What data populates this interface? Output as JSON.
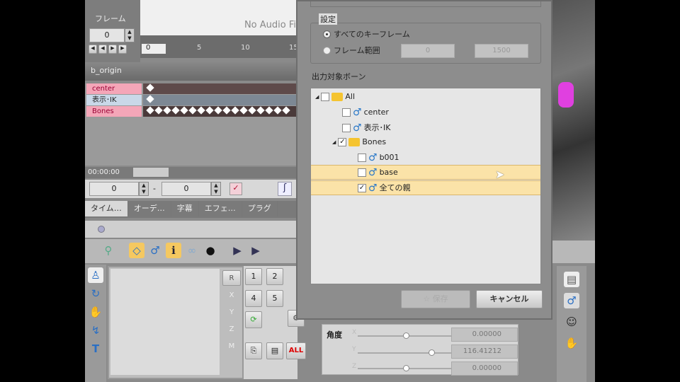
{
  "frame_panel": {
    "label": "フレーム",
    "value": "0"
  },
  "audio": {
    "text": "No Audio Fi"
  },
  "ruler": {
    "current": "0",
    "ticks": [
      "5",
      "10",
      "15"
    ]
  },
  "model": {
    "name": "b_origin"
  },
  "tracks": [
    {
      "label": "center",
      "color": "#f4a6b8"
    },
    {
      "label": "表示･IK",
      "color": "#c9d8e8"
    },
    {
      "label": "Bones",
      "color": "#f4a6b8"
    }
  ],
  "time": {
    "display": "00:00:00"
  },
  "range": {
    "start": "0",
    "sep": "-",
    "end": "0"
  },
  "tabs": [
    "タイム…",
    "オーデ…",
    "字幕",
    "エフェ…",
    "プラグ"
  ],
  "axis_buttons": [
    "R",
    "X",
    "Y",
    "Z",
    "M"
  ],
  "number_buttons": [
    "1",
    "2",
    "4",
    "5"
  ],
  "all_button": "ALL",
  "dialog": {
    "settings_label": "設定",
    "radio_all": "すべてのキーフレーム",
    "radio_range": "フレーム範囲",
    "range_start": "0",
    "range_end": "1500",
    "bones_label": "出力対象ボーン",
    "tree": [
      {
        "label": "All",
        "type": "folder",
        "checked": false
      },
      {
        "label": "center",
        "type": "bone",
        "checked": false
      },
      {
        "label": "表示･IK",
        "type": "bone",
        "checked": false
      },
      {
        "label": "Bones",
        "type": "folder",
        "checked": true
      },
      {
        "label": "b001",
        "type": "bone",
        "checked": false
      },
      {
        "label": "base",
        "type": "bone",
        "checked": false
      },
      {
        "label": "全ての親",
        "type": "bone",
        "checked": true
      }
    ],
    "save_label": "保存",
    "cancel_label": "キャンセル"
  },
  "angle": {
    "label": "角度",
    "values": [
      "0.00000",
      "116.41212",
      "0.00000"
    ],
    "axes": [
      "X",
      "Y",
      "Z"
    ]
  }
}
